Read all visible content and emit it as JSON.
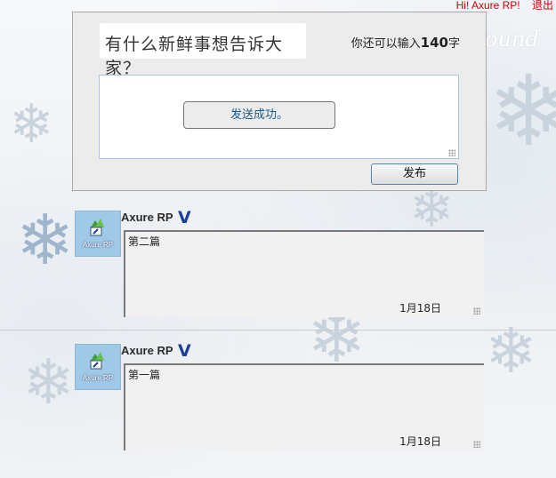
{
  "header": {
    "greeting": "Hi! Axure RP!",
    "logout": "退出"
  },
  "background": {
    "word": "ound"
  },
  "compose": {
    "slogan": "有什么新鲜事想告诉大家？",
    "counter_prefix": "你还可以输入",
    "counter_value": "140",
    "counter_suffix": "字",
    "toast": "发送成功。",
    "publish_label": "发布"
  },
  "posts": [
    {
      "author": "Axure RP",
      "verified": "V",
      "avatar_caption": "Axure RP",
      "text": "第二篇",
      "date": "1月18日"
    },
    {
      "author": "Axure RP",
      "verified": "V",
      "avatar_caption": "Axure RP",
      "text": "第一篇",
      "date": "1月18日"
    }
  ],
  "colors": {
    "link": "#cc0000",
    "verified": "#1d3f9a",
    "toast_text": "#1b5a8c"
  }
}
